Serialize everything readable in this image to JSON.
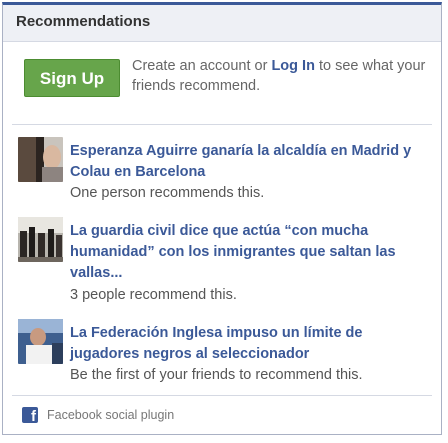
{
  "header": {
    "title": "Recommendations"
  },
  "signup": {
    "button_label": "Sign Up",
    "text_before": "Create an account or ",
    "login_label": "Log In",
    "text_after": " to see what your friends recommend."
  },
  "recommendations": [
    {
      "title": "Esperanza Aguirre ganaría la alcaldía en Madrid y Colau en Barcelona",
      "subtitle": "One person recommends this.",
      "thumb_icon": "news-photo-thumbnail"
    },
    {
      "title": "La guardia civil dice que actúa “con mucha humanidad” con los inmigrantes que saltan las vallas...",
      "subtitle": "3 people recommend this.",
      "thumb_icon": "news-photo-thumbnail"
    },
    {
      "title": "La Federación Inglesa impuso un límite de jugadores negros al seleccionador",
      "subtitle": "Be the first of your friends to recommend this.",
      "thumb_icon": "news-photo-thumbnail"
    }
  ],
  "footer": {
    "label": "Facebook social plugin",
    "icon": "facebook-icon"
  },
  "colors": {
    "brand": "#3b5998",
    "signup_green": "#67a54b",
    "header_bg": "#eef0f5"
  }
}
